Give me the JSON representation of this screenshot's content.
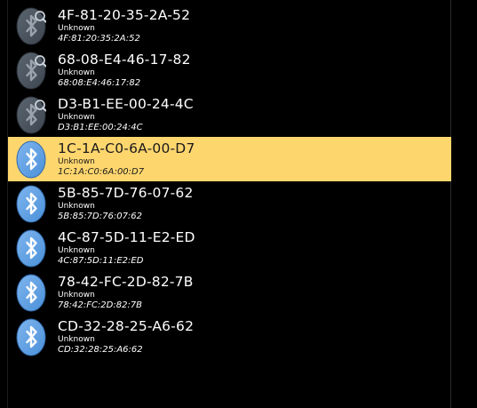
{
  "devices": [
    {
      "name": "4F-81-20-35-2A-52",
      "type": "Unknown",
      "address": "4F:81:20:35:2A:52",
      "icon": "bluetooth-searching-icon",
      "selected": false
    },
    {
      "name": "68-08-E4-46-17-82",
      "type": "Unknown",
      "address": "68:08:E4:46:17:82",
      "icon": "bluetooth-searching-icon",
      "selected": false
    },
    {
      "name": "D3-B1-EE-00-24-4C",
      "type": "Unknown",
      "address": "D3:B1:EE:00:24:4C",
      "icon": "bluetooth-searching-icon",
      "selected": false
    },
    {
      "name": "1C-1A-C0-6A-00-D7",
      "type": "Unknown",
      "address": "1C:1A:C0:6A:00:D7",
      "icon": "bluetooth-icon",
      "selected": true
    },
    {
      "name": "5B-85-7D-76-07-62",
      "type": "Unknown",
      "address": "5B:85:7D:76:07:62",
      "icon": "bluetooth-icon",
      "selected": false
    },
    {
      "name": "4C-87-5D-11-E2-ED",
      "type": "Unknown",
      "address": "4C:87:5D:11:E2:ED",
      "icon": "bluetooth-icon",
      "selected": false
    },
    {
      "name": "78-42-FC-2D-82-7B",
      "type": "Unknown",
      "address": "78:42:FC:2D:82:7B",
      "icon": "bluetooth-icon",
      "selected": false
    },
    {
      "name": "CD-32-28-25-A6-62",
      "type": "Unknown",
      "address": "CD:32:28:25:A6:62",
      "icon": "bluetooth-icon",
      "selected": false
    }
  ],
  "colors": {
    "selected_background": "#fed66e",
    "background": "#000000",
    "bluetooth_active": "#4a90d9",
    "bluetooth_inactive": "#3d4650"
  }
}
